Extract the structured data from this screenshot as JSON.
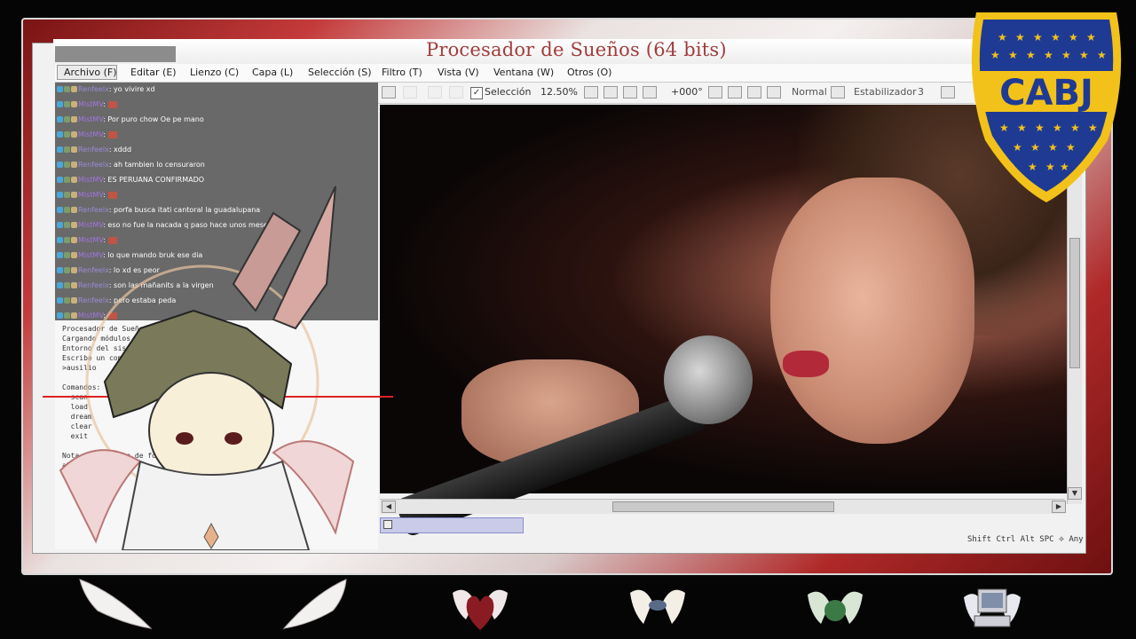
{
  "window": {
    "title": "Procesador de Sueños (64 bits)"
  },
  "menu": {
    "items": [
      "Archivo (F)",
      "Editar (E)",
      "Lienzo (C)",
      "Capa (L)",
      "Selección (S)",
      "Filtro (T)",
      "Vista (V)",
      "Ventana (W)",
      "Otros (O)"
    ]
  },
  "toolbar": {
    "selection_label": "Selección",
    "zoom": "12.50%",
    "rotation": "+000°",
    "blend_mode": "Normal",
    "stabilizer_label": "Estabilizador",
    "stabilizer_value": "3"
  },
  "status_bar": {
    "modifiers": "Shift Ctrl Alt SPC ⟡ Any"
  },
  "chat": {
    "messages": [
      {
        "user": "Renfeelx",
        "text": ": yo vivire xd",
        "color": "#9c8ad9"
      },
      {
        "user": "MistMV",
        "text": ":",
        "emote": true,
        "color": "#a474e4"
      },
      {
        "user": "MistMV",
        "text": ": Por puro chow Oe pe mano",
        "color": "#a474e4"
      },
      {
        "user": "MistMV",
        "text": ":",
        "emote": true,
        "color": "#a474e4"
      },
      {
        "user": "Renfeelx",
        "text": ": xddd",
        "color": "#9c8ad9"
      },
      {
        "user": "Renfeelx",
        "text": ": ah tambien lo censuraron",
        "color": "#9c8ad9"
      },
      {
        "user": "MistMV",
        "text": ": ES PERUANA CONFIRMADO",
        "color": "#a474e4"
      },
      {
        "user": "MistMV",
        "text": ":",
        "emote": true,
        "color": "#a474e4"
      },
      {
        "user": "Renfeelx",
        "text": ": porfa busca itati cantoral la guadalupana",
        "color": "#9c8ad9"
      },
      {
        "user": "MistMV",
        "text": ": eso no fue la nacada q paso hace unos meses?",
        "color": "#a474e4"
      },
      {
        "user": "MistMV",
        "text": ":",
        "emote": true,
        "color": "#a474e4"
      },
      {
        "user": "MistMV",
        "text": ": lo que mando bruk ese dia",
        "color": "#a474e4"
      },
      {
        "user": "Renfeelx",
        "text": ": lo xd es peor",
        "color": "#9c8ad9"
      },
      {
        "user": "Renfeelx",
        "text": ": son las mañanits a la virgen",
        "color": "#9c8ad9"
      },
      {
        "user": "Renfeelx",
        "text": ": pero estaba peda",
        "color": "#9c8ad9"
      },
      {
        "user": "MistMV",
        "text": ":",
        "emote": true,
        "color": "#a474e4"
      }
    ]
  },
  "console": {
    "lines": [
      "Procesador de Sueños v2.4.1 (x64)",
      "Cargando módulos ....... OK",
      "Entorno del sistema ........ OK",
      "Escribe un comando:",
      ">ausilio",
      "",
      "Comandos:",
      "  scan",
      "  load",
      "  dream",
      "  clear",
      "  exit",
      "",
      "Nota: e compacte de forma",
      "aleatoria                 cuando",
      "impor"
    ]
  },
  "logo": {
    "text": "CABJ",
    "primary_color": "#1f3a93",
    "secondary_color": "#f2c21b"
  },
  "dock": {
    "icons": [
      "winged-heart-icon",
      "winged-eye-icon",
      "winged-orb-icon",
      "computer-icon"
    ]
  }
}
